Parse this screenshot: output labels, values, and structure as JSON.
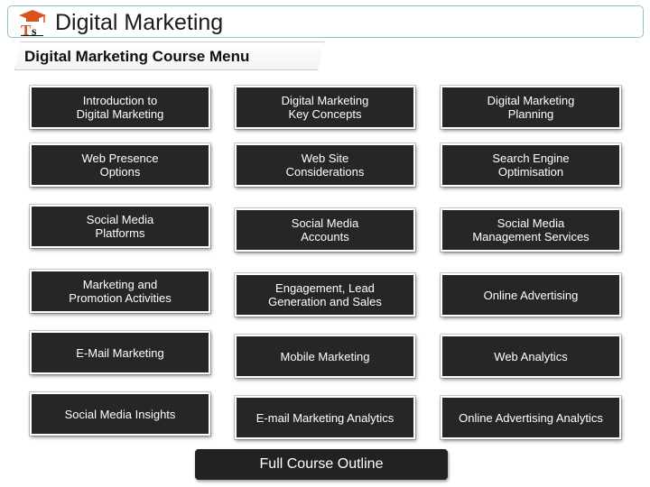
{
  "header": {
    "logo_text": "Ts",
    "title": "Digital Marketing"
  },
  "subtitle": "Digital Marketing Course Menu",
  "colors": {
    "button_bg": "#262626",
    "button_text": "#ffffff",
    "title_border": "#8fc3d4",
    "logo_orange": "#d9531e"
  },
  "menu": [
    "Introduction to\nDigital Marketing",
    "Digital Marketing\nKey Concepts",
    "Digital Marketing\nPlanning",
    "Web Presence\nOptions",
    "Web Site\nConsiderations",
    "Search Engine\nOptimisation",
    "Social Media\nPlatforms",
    "Social Media\nAccounts",
    "Social Media\nManagement Services",
    "Marketing and\nPromotion Activities",
    "Engagement, Lead\nGeneration and Sales",
    "Online Advertising",
    "E-Mail Marketing",
    "Mobile Marketing",
    "Web Analytics",
    "Social Media Insights",
    "E-mail Marketing Analytics",
    "Online Advertising Analytics"
  ],
  "footer": {
    "outline_label": "Full Course Outline"
  }
}
